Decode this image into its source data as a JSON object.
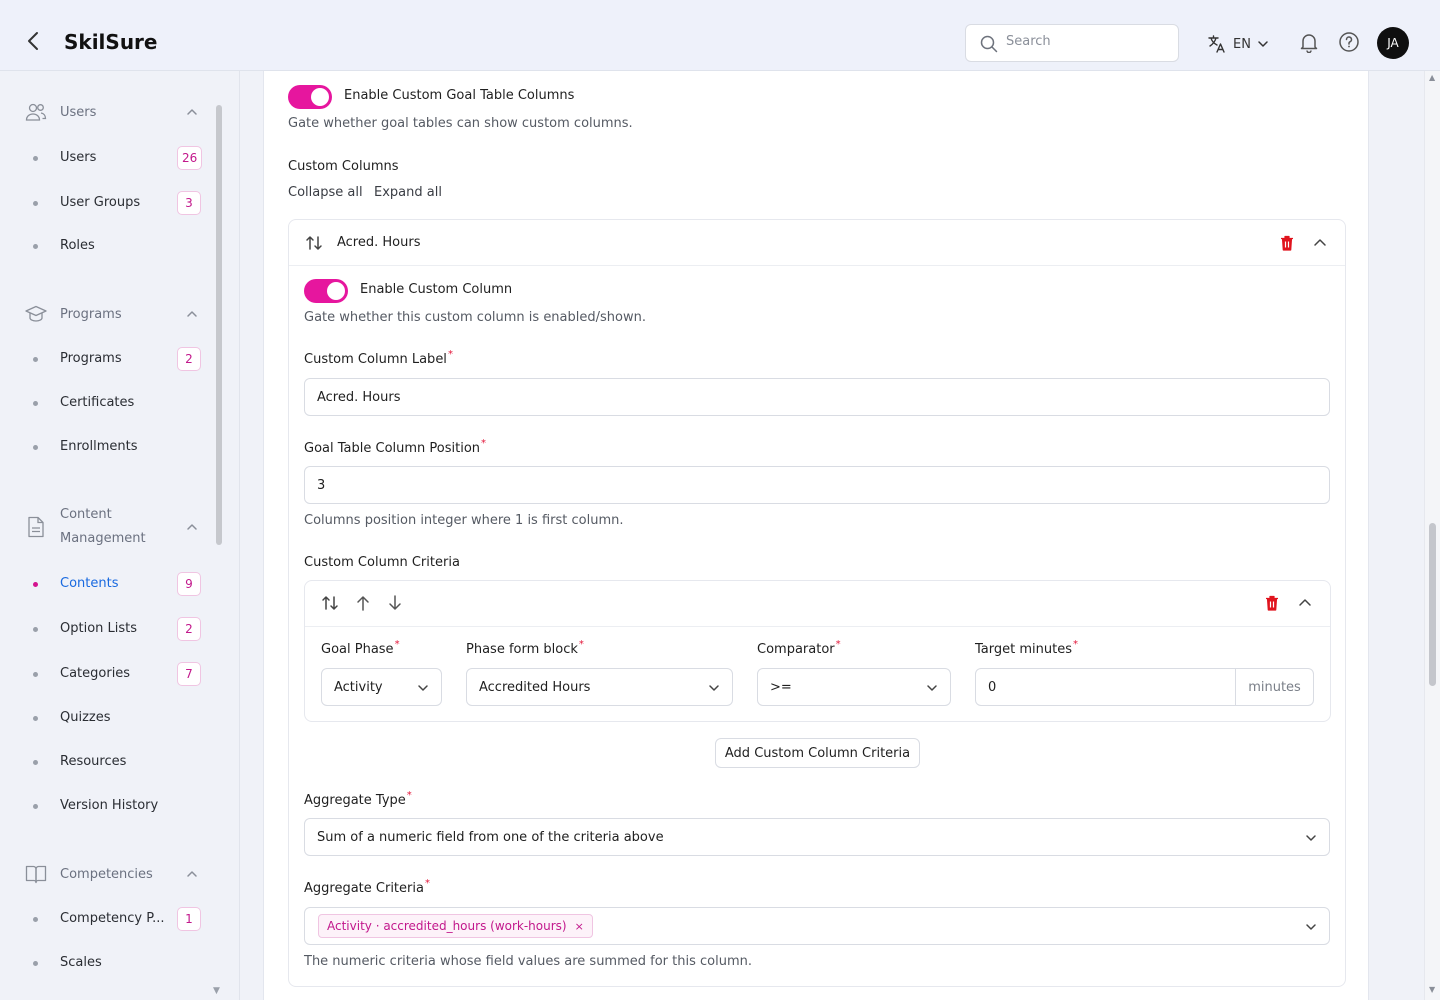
{
  "app": {
    "title": "SkilSure"
  },
  "header": {
    "search_placeholder": "Search",
    "language": "EN",
    "avatar_initials": "JA"
  },
  "sidebar": {
    "sections": [
      {
        "label": "Users",
        "items": [
          {
            "label": "Users",
            "badge": "26"
          },
          {
            "label": "User Groups",
            "badge": "3"
          },
          {
            "label": "Roles"
          }
        ]
      },
      {
        "label": "Programs",
        "items": [
          {
            "label": "Programs",
            "badge": "2"
          },
          {
            "label": "Certificates"
          },
          {
            "label": "Enrollments"
          }
        ]
      },
      {
        "label_line1": "Content",
        "label_line2": "Management",
        "items": [
          {
            "label": "Contents",
            "badge": "9"
          },
          {
            "label": "Option Lists",
            "badge": "2"
          },
          {
            "label": "Categories",
            "badge": "7"
          },
          {
            "label": "Quizzes"
          },
          {
            "label": "Resources"
          },
          {
            "label": "Version History"
          }
        ]
      },
      {
        "label": "Competencies",
        "items": [
          {
            "label": "Competency P...",
            "badge": "1"
          },
          {
            "label": "Scales"
          }
        ]
      }
    ]
  },
  "main": {
    "enable_goal_columns": {
      "label": "Enable Custom Goal Table Columns",
      "help": "Gate whether goal tables can show custom columns."
    },
    "custom_columns": {
      "title": "Custom Columns",
      "collapse_all": "Collapse all",
      "expand_all": "Expand all"
    },
    "column": {
      "name": "Acred. Hours",
      "enable": {
        "label": "Enable Custom Column",
        "help": "Gate whether this custom column is enabled/shown."
      },
      "label_field": {
        "label": "Custom Column Label",
        "required": "*",
        "value": "Acred. Hours"
      },
      "position_field": {
        "label": "Goal Table Column Position",
        "required": "*",
        "value": "3",
        "help": "Columns position integer where 1 is first column."
      },
      "criteria_title": "Custom Column Criteria",
      "criteria": {
        "goal_phase": {
          "label": "Goal Phase",
          "required": "*",
          "value": "Activity"
        },
        "phase_form_block": {
          "label": "Phase form block",
          "required": "*",
          "value": "Accredited Hours"
        },
        "comparator": {
          "label": "Comparator",
          "required": "*",
          "value": ">="
        },
        "target_minutes": {
          "label": "Target minutes",
          "required": "*",
          "value": "0",
          "unit": "minutes"
        }
      },
      "add_criteria_button": "Add Custom Column Criteria",
      "aggregate_type": {
        "label": "Aggregate Type",
        "required": "*",
        "value": "Sum of a numeric field from one of the criteria above"
      },
      "aggregate_criteria": {
        "label": "Aggregate Criteria",
        "required": "*",
        "tag": "Activity · accredited_hours (work-hours)",
        "tag_remove": "×",
        "help": "The numeric criteria whose field values are summed for this column."
      }
    }
  },
  "colors": {
    "accent": "#e6169e",
    "badge_text": "#c2188c",
    "active_link": "#1a6ae0",
    "danger": "#e0141e"
  }
}
